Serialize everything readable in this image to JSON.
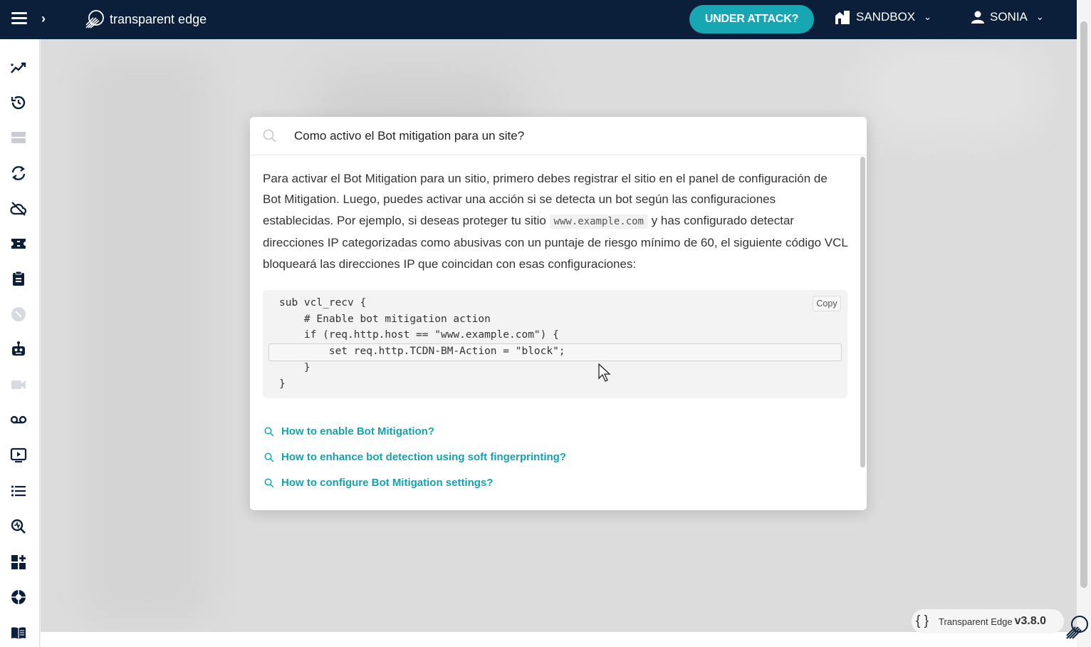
{
  "app": {
    "brand": "transparent edge",
    "attack_label": "UNDER ATTACK?",
    "workspace": "SANDBOX",
    "user": "SONIA",
    "colors": {
      "navy": "#0c1f3a",
      "accent": "#16a7b3",
      "link": "#17a0ad"
    }
  },
  "sidebar": {
    "icons": [
      "analytics-icon",
      "history-icon",
      "servers-icon",
      "sync-icon",
      "cloud-off-icon",
      "ticket-icon",
      "clipboard-icon",
      "disabled-circle-icon",
      "robot-icon",
      "video-icon",
      "voicemail-icon",
      "player-icon",
      "list-icon",
      "inspect-icon",
      "dashboard-add-icon",
      "support-icon",
      "docs-book-icon"
    ]
  },
  "search": {
    "query": "Como activo el Bot mitigation para un site?"
  },
  "answer": {
    "part1": "Para activar el Bot Mitigation para un sitio, primero debes registrar el sitio en el panel de configuración de Bot Mitigation. Luego, puedes activar una acción si se detecta un bot según las configuraciones establecidas. Por ejemplo, si deseas proteger tu sitio ",
    "code_inline": "www.example.com",
    "part2": " y has configurado detectar direcciones IP categorizadas como abusivas con un puntaje de riesgo mínimo de 60, el siguiente código VCL bloqueará las direcciones IP que coincidan con esas configuraciones:"
  },
  "code": {
    "copy_label": "Copy",
    "lines": [
      "sub vcl_recv {",
      "    # Enable bot mitigation action",
      "    if (req.http.host == \"www.example.com\") {",
      "        set req.http.TCDN-BM-Action = \"block\";",
      "    }",
      "}"
    ]
  },
  "suggestions": [
    "How to enable Bot Mitigation?",
    "How to enhance bot detection using soft fingerprinting?",
    "How to configure Bot Mitigation settings?"
  ],
  "version": {
    "product": "Transparent Edge",
    "number": "v3.8.0"
  }
}
